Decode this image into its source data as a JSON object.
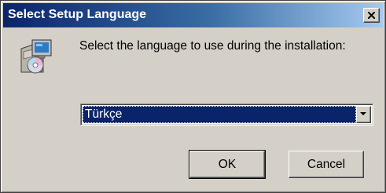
{
  "window": {
    "title": "Select Setup Language",
    "close_icon": "close-x-icon",
    "titlebar_gradient": [
      "#0a246a",
      "#a6caf0"
    ]
  },
  "dialog": {
    "icon": "setup-computer-cd-icon",
    "prompt": "Select the language to use during the installation:",
    "language_select": {
      "selected": "Türkçe",
      "arrow_icon": "chevron-down-icon"
    },
    "buttons": {
      "ok": "OK",
      "cancel": "Cancel"
    }
  }
}
